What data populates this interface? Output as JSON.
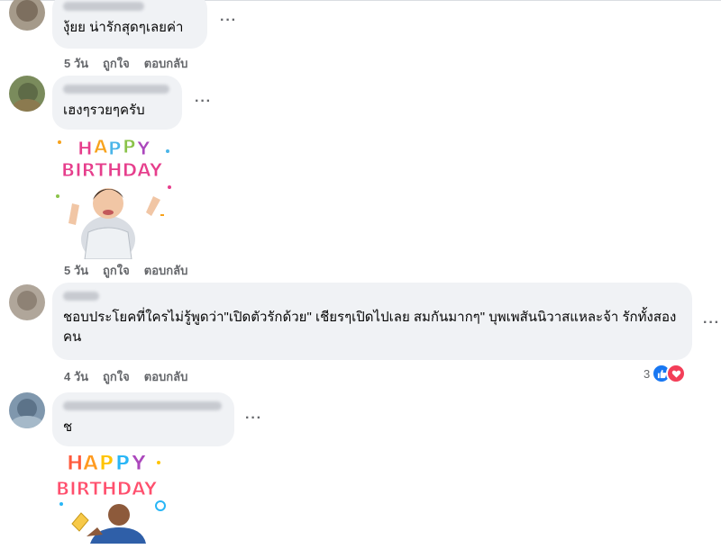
{
  "comments": [
    {
      "text": "งุ้ยย น่ารักสุดๆเลยค่า",
      "time": "5 วัน",
      "like": "ถูกใจ",
      "reply": "ตอบกลับ",
      "more": "···"
    },
    {
      "text": "เฮงๆรวยๆครับ",
      "time": "5 วัน",
      "like": "ถูกใจ",
      "reply": "ตอบกลับ",
      "more": "···",
      "sticker": {
        "line1": "HAPPY",
        "line2": "BIRTHDAY"
      }
    },
    {
      "text": "ชอบประโยคที่ใครไม่รู้พูดว่า\"เปิดตัวรักด้วย\" เชียรๆเปิดไปเลย สมกันมากๆ\" บุพเพสันนิวาสแหละจ้า รักทั้งสองคน",
      "time": "4 วัน",
      "like": "ถูกใจ",
      "reply": "ตอบกลับ",
      "more": "···",
      "reaction_count": "3"
    },
    {
      "text": "ช",
      "time": "",
      "like": "",
      "reply": "",
      "more": "···",
      "sticker": {
        "line1": "HAPPY",
        "line2": "BIRTHDAY"
      }
    }
  ],
  "colors": {
    "bubble": "#f0f2f5",
    "meta": "#65676b",
    "like_blue": "#1877f2",
    "love_red": "#f33e58"
  },
  "icons": [
    "like-reaction-icon",
    "love-reaction-icon",
    "more-options-icon"
  ]
}
